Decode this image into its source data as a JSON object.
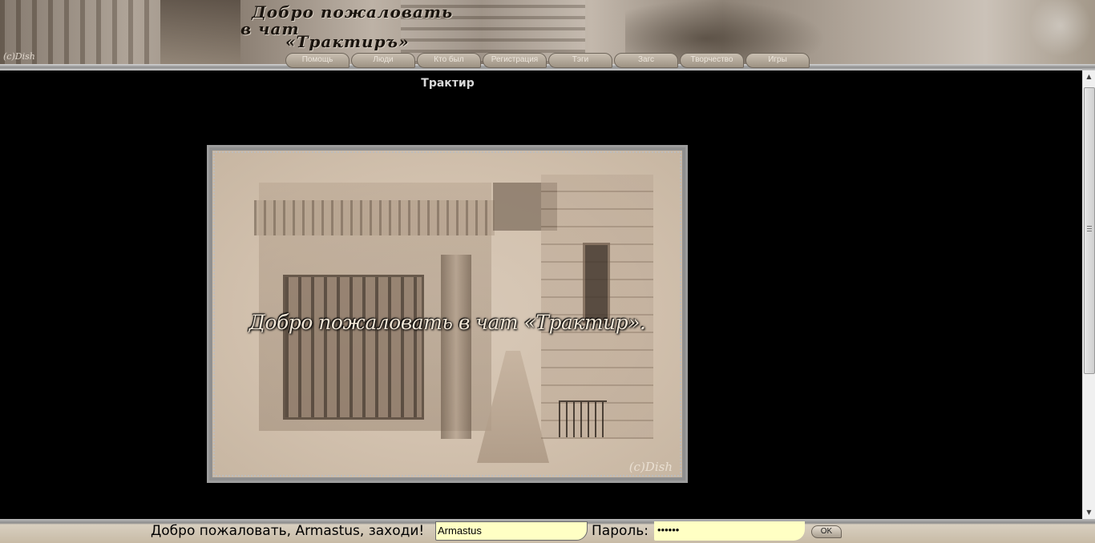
{
  "header": {
    "title_lines": [
      "Добро пожаловать",
      "в чат",
      "«Трактиръ»"
    ],
    "copyright": "(c)Dish"
  },
  "nav": {
    "tabs": [
      {
        "label": "Помощь"
      },
      {
        "label": "Люди"
      },
      {
        "label": "Кто был"
      },
      {
        "label": "Регистрация"
      },
      {
        "label": "Тэги"
      },
      {
        "label": "Загс"
      },
      {
        "label": "Творчество"
      },
      {
        "label": "Игры"
      }
    ]
  },
  "main": {
    "room_name": "Трактир",
    "welcome_image": {
      "caption": "Добро пожаловать в чат «Трактир».",
      "copyright": "(c)Dish"
    }
  },
  "scrollbar": {
    "up_icon": "scroll-up-arrow",
    "down_icon": "scroll-down-arrow"
  },
  "login": {
    "welcome_text": "Добро пожаловать, Armastus, заходи!",
    "login_value": "Armastus",
    "password_label": "Пароль:",
    "password_value": "••••••",
    "ok_label": "OK"
  }
}
